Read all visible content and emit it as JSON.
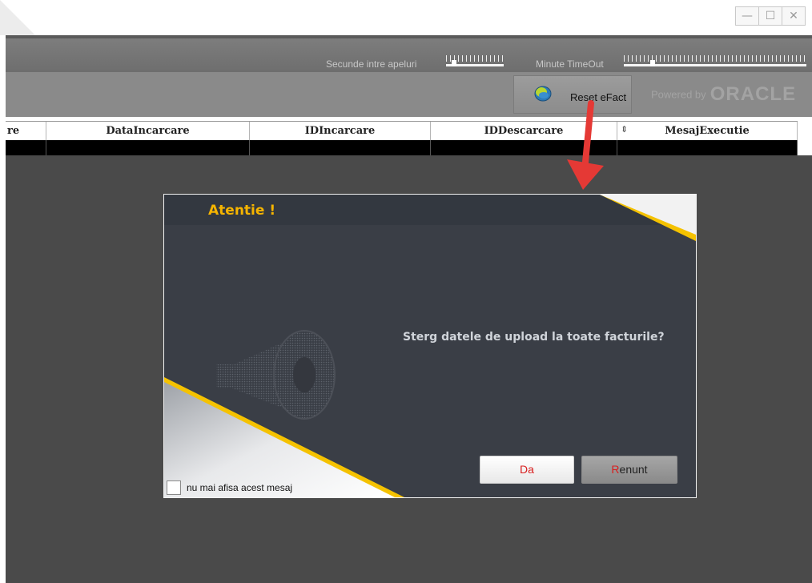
{
  "window": {
    "controls": {
      "minimize": "—",
      "maximize": "☐",
      "close": "✕"
    }
  },
  "settings_bar": {
    "interval_label": "Secunde intre apeluri",
    "timeout_label": "Minute TimeOut",
    "interval_value": 0.1,
    "timeout_value": 0.15
  },
  "toolbar": {
    "reset_label": "Reset eFact",
    "reset_icon": "globe-icon",
    "powered_by": "Powered by",
    "oracle_logo": "ORACLE"
  },
  "grid": {
    "columns": [
      "re",
      "DataIncarcare",
      "IDIncarcare",
      "IDDescarcare",
      "MesajExecutie"
    ],
    "sort_icon": "⇕"
  },
  "dialog": {
    "title": "Atentie !",
    "message": "Sterg datele de upload la toate facturile?",
    "yes_label": "Da",
    "cancel_hot": "R",
    "cancel_rest": "enunt",
    "dont_show_label": "nu mai afisa acest mesaj",
    "icon": "megaphone-icon"
  },
  "colors": {
    "accent_yellow": "#f5b400",
    "hotkey_red": "#d81e1e",
    "annotation_red": "#e53935"
  }
}
